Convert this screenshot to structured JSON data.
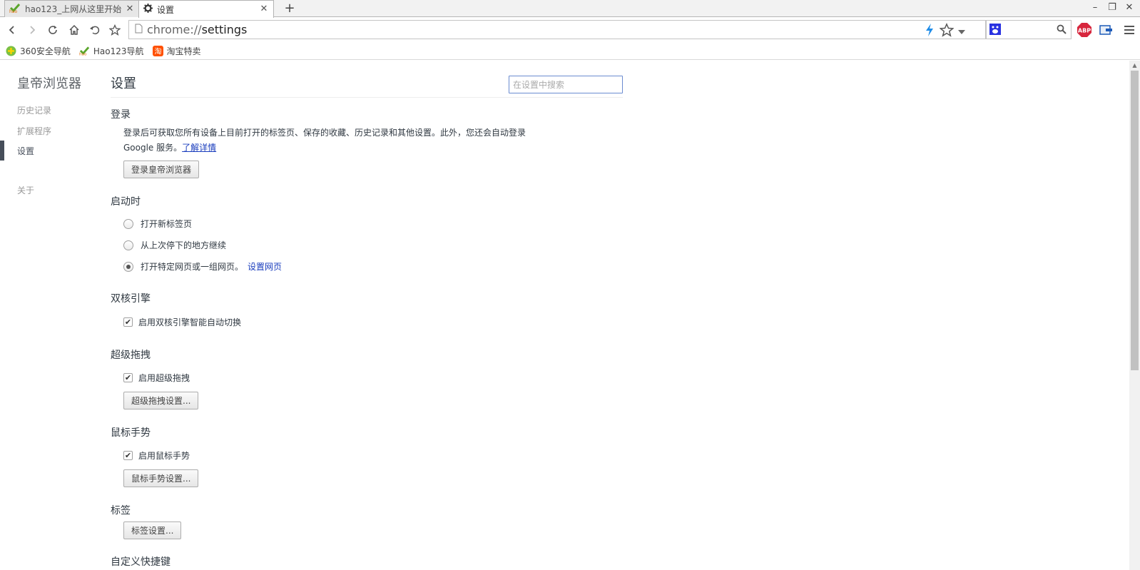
{
  "tabs": [
    {
      "title": "hao123_上网从这里开始",
      "icon": "hao-icon",
      "active": false
    },
    {
      "title": "设置",
      "icon": "gear-icon",
      "active": true
    }
  ],
  "omnibox": {
    "scheme": "chrome://",
    "path": "settings"
  },
  "bookmarks": [
    {
      "label": "360安全导航",
      "icon": "360-icon"
    },
    {
      "label": "Hao123导航",
      "icon": "hao-icon"
    },
    {
      "label": "淘宝特卖",
      "icon": "taobao-icon"
    }
  ],
  "extensions": {
    "abp_label": "ABP"
  },
  "nav": {
    "title": "皇帝浏览器",
    "items": [
      "历史记录",
      "扩展程序",
      "设置",
      "关于"
    ],
    "selected": "设置"
  },
  "main": {
    "title": "设置",
    "search_placeholder": "在设置中搜索",
    "signin": {
      "title": "登录",
      "text1": "登录后可获取您所有设备上目前打开的标签页、保存的收藏、历史记录和其他设置。此外，您还会自动登录",
      "text2": "Google 服务。",
      "link": "了解详情",
      "button": "登录皇帝浏览器"
    },
    "startup": {
      "title": "启动时",
      "options": [
        "打开新标签页",
        "从上次停下的地方继续",
        "打开特定网页或一组网页。"
      ],
      "selected_index": 2,
      "link": "设置网页"
    },
    "engine": {
      "title": "双核引擎",
      "checkbox": "启用双核引擎智能自动切换",
      "checked": true
    },
    "drag": {
      "title": "超级拖拽",
      "checkbox": "启用超级拖拽",
      "checked": true,
      "button": "超级拖拽设置..."
    },
    "gesture": {
      "title": "鼠标手势",
      "checkbox": "启用鼠标手势",
      "checked": true,
      "button": "鼠标手势设置..."
    },
    "tabs_section": {
      "title": "标签",
      "button": "标签设置..."
    },
    "next_title": "自定义快捷键"
  },
  "colors": {
    "accent": "#1a3dbd",
    "focus": "#6a8bd0",
    "abp": "#d7263d"
  }
}
